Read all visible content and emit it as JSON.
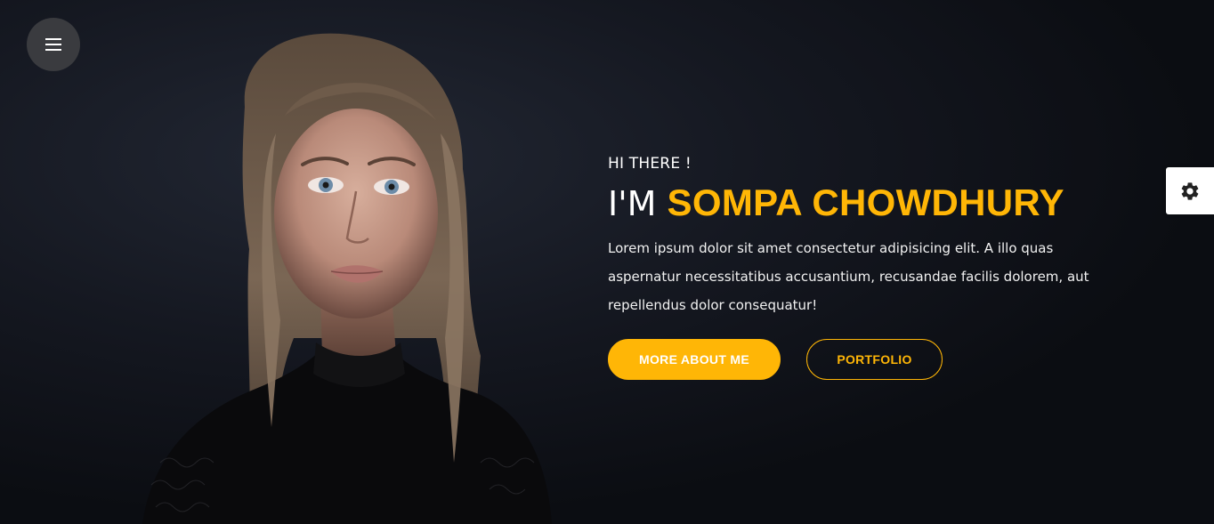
{
  "nav": {
    "menu_icon": "hamburger-icon",
    "settings_icon": "gear-icon"
  },
  "hero": {
    "greeting": "HI THERE !",
    "headline_prefix": "I'M ",
    "name": "SOMPA CHOWDHURY",
    "intro": "Lorem ipsum dolor sit amet consectetur adipisicing elit. A illo quas aspernatur necessitatibus accusantium, recusandae facilis dolorem, aut repellendus dolor consequatur!",
    "primary_button_label": "MORE ABOUT ME",
    "secondary_button_label": "PORTFOLIO"
  },
  "colors": {
    "accent": "#ffb606",
    "background": "#0b0d12",
    "menu_button_bg": "#3a3b3f"
  }
}
